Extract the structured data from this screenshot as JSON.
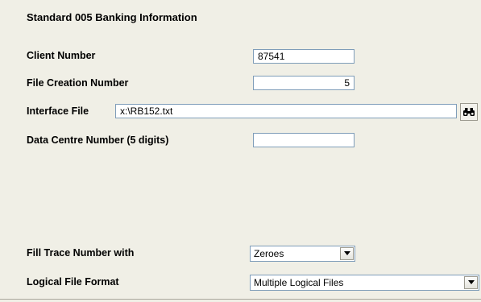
{
  "section": {
    "title": "Standard 005 Banking Information"
  },
  "fields": {
    "client_number": {
      "label": "Client Number",
      "value": "87541"
    },
    "file_creation_number": {
      "label": "File Creation Number",
      "value": "5"
    },
    "interface_file": {
      "label": "Interface File",
      "value": "x:\\RB152.txt",
      "browse_icon": "binoculars-icon"
    },
    "data_centre_number": {
      "label": "Data Centre Number (5 digits)",
      "value": ""
    },
    "fill_trace_number": {
      "label": "Fill Trace Number with",
      "selected": "Zeroes"
    },
    "logical_file_format": {
      "label": "Logical File Format",
      "selected": "Multiple Logical Files"
    }
  },
  "colors": {
    "background": "#f0efe6",
    "field_border": "#7f9db9"
  }
}
